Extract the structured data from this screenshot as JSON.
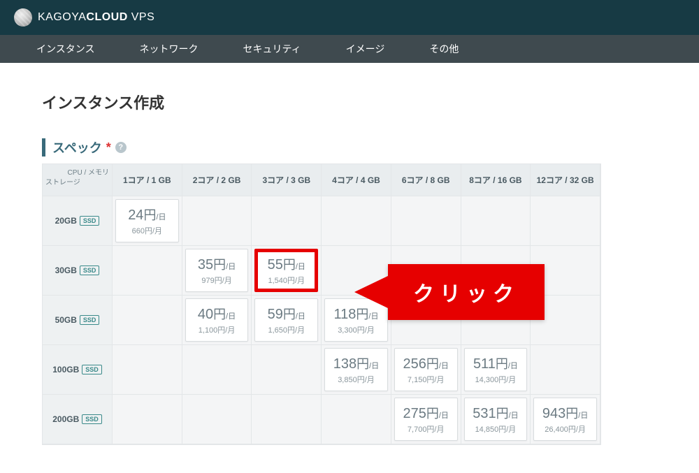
{
  "brand": {
    "name1": "KAGOYA",
    "name2": "CLOUD",
    "name3": " VPS"
  },
  "nav": [
    "インスタンス",
    "ネットワーク",
    "セキュリティ",
    "イメージ",
    "その他"
  ],
  "page_title": "インスタンス作成",
  "section": {
    "title": "スペック",
    "required": "*"
  },
  "corner": {
    "top": "CPU / メモリ",
    "bottom": "ストレージ"
  },
  "cols": [
    "1コア / 1 GB",
    "2コア / 2 GB",
    "3コア / 3 GB",
    "4コア / 4 GB",
    "6コア / 8 GB",
    "8コア / 16 GB",
    "12コア / 32 GB"
  ],
  "storage_badge": "SSD",
  "rows": [
    {
      "size": "20GB",
      "cells": [
        {
          "day": "24",
          "mon": "660"
        },
        null,
        null,
        null,
        null,
        null,
        null
      ]
    },
    {
      "size": "30GB",
      "cells": [
        null,
        {
          "day": "35",
          "mon": "979"
        },
        {
          "day": "55",
          "mon": "1,540",
          "hl": true
        },
        null,
        null,
        null,
        null
      ]
    },
    {
      "size": "50GB",
      "cells": [
        null,
        {
          "day": "40",
          "mon": "1,100"
        },
        {
          "day": "59",
          "mon": "1,650"
        },
        {
          "day": "118",
          "mon": "3,300"
        },
        null,
        null,
        null
      ]
    },
    {
      "size": "100GB",
      "cells": [
        null,
        null,
        null,
        {
          "day": "138",
          "mon": "3,850"
        },
        {
          "day": "256",
          "mon": "7,150"
        },
        {
          "day": "511",
          "mon": "14,300"
        },
        null
      ]
    },
    {
      "size": "200GB",
      "cells": [
        null,
        null,
        null,
        null,
        {
          "day": "275",
          "mon": "7,700"
        },
        {
          "day": "531",
          "mon": "14,850"
        },
        {
          "day": "943",
          "mon": "26,400"
        }
      ]
    }
  ],
  "unit": {
    "yen": "円",
    "per_day": "/日",
    "per_month": "円/月"
  },
  "callout": "クリック"
}
